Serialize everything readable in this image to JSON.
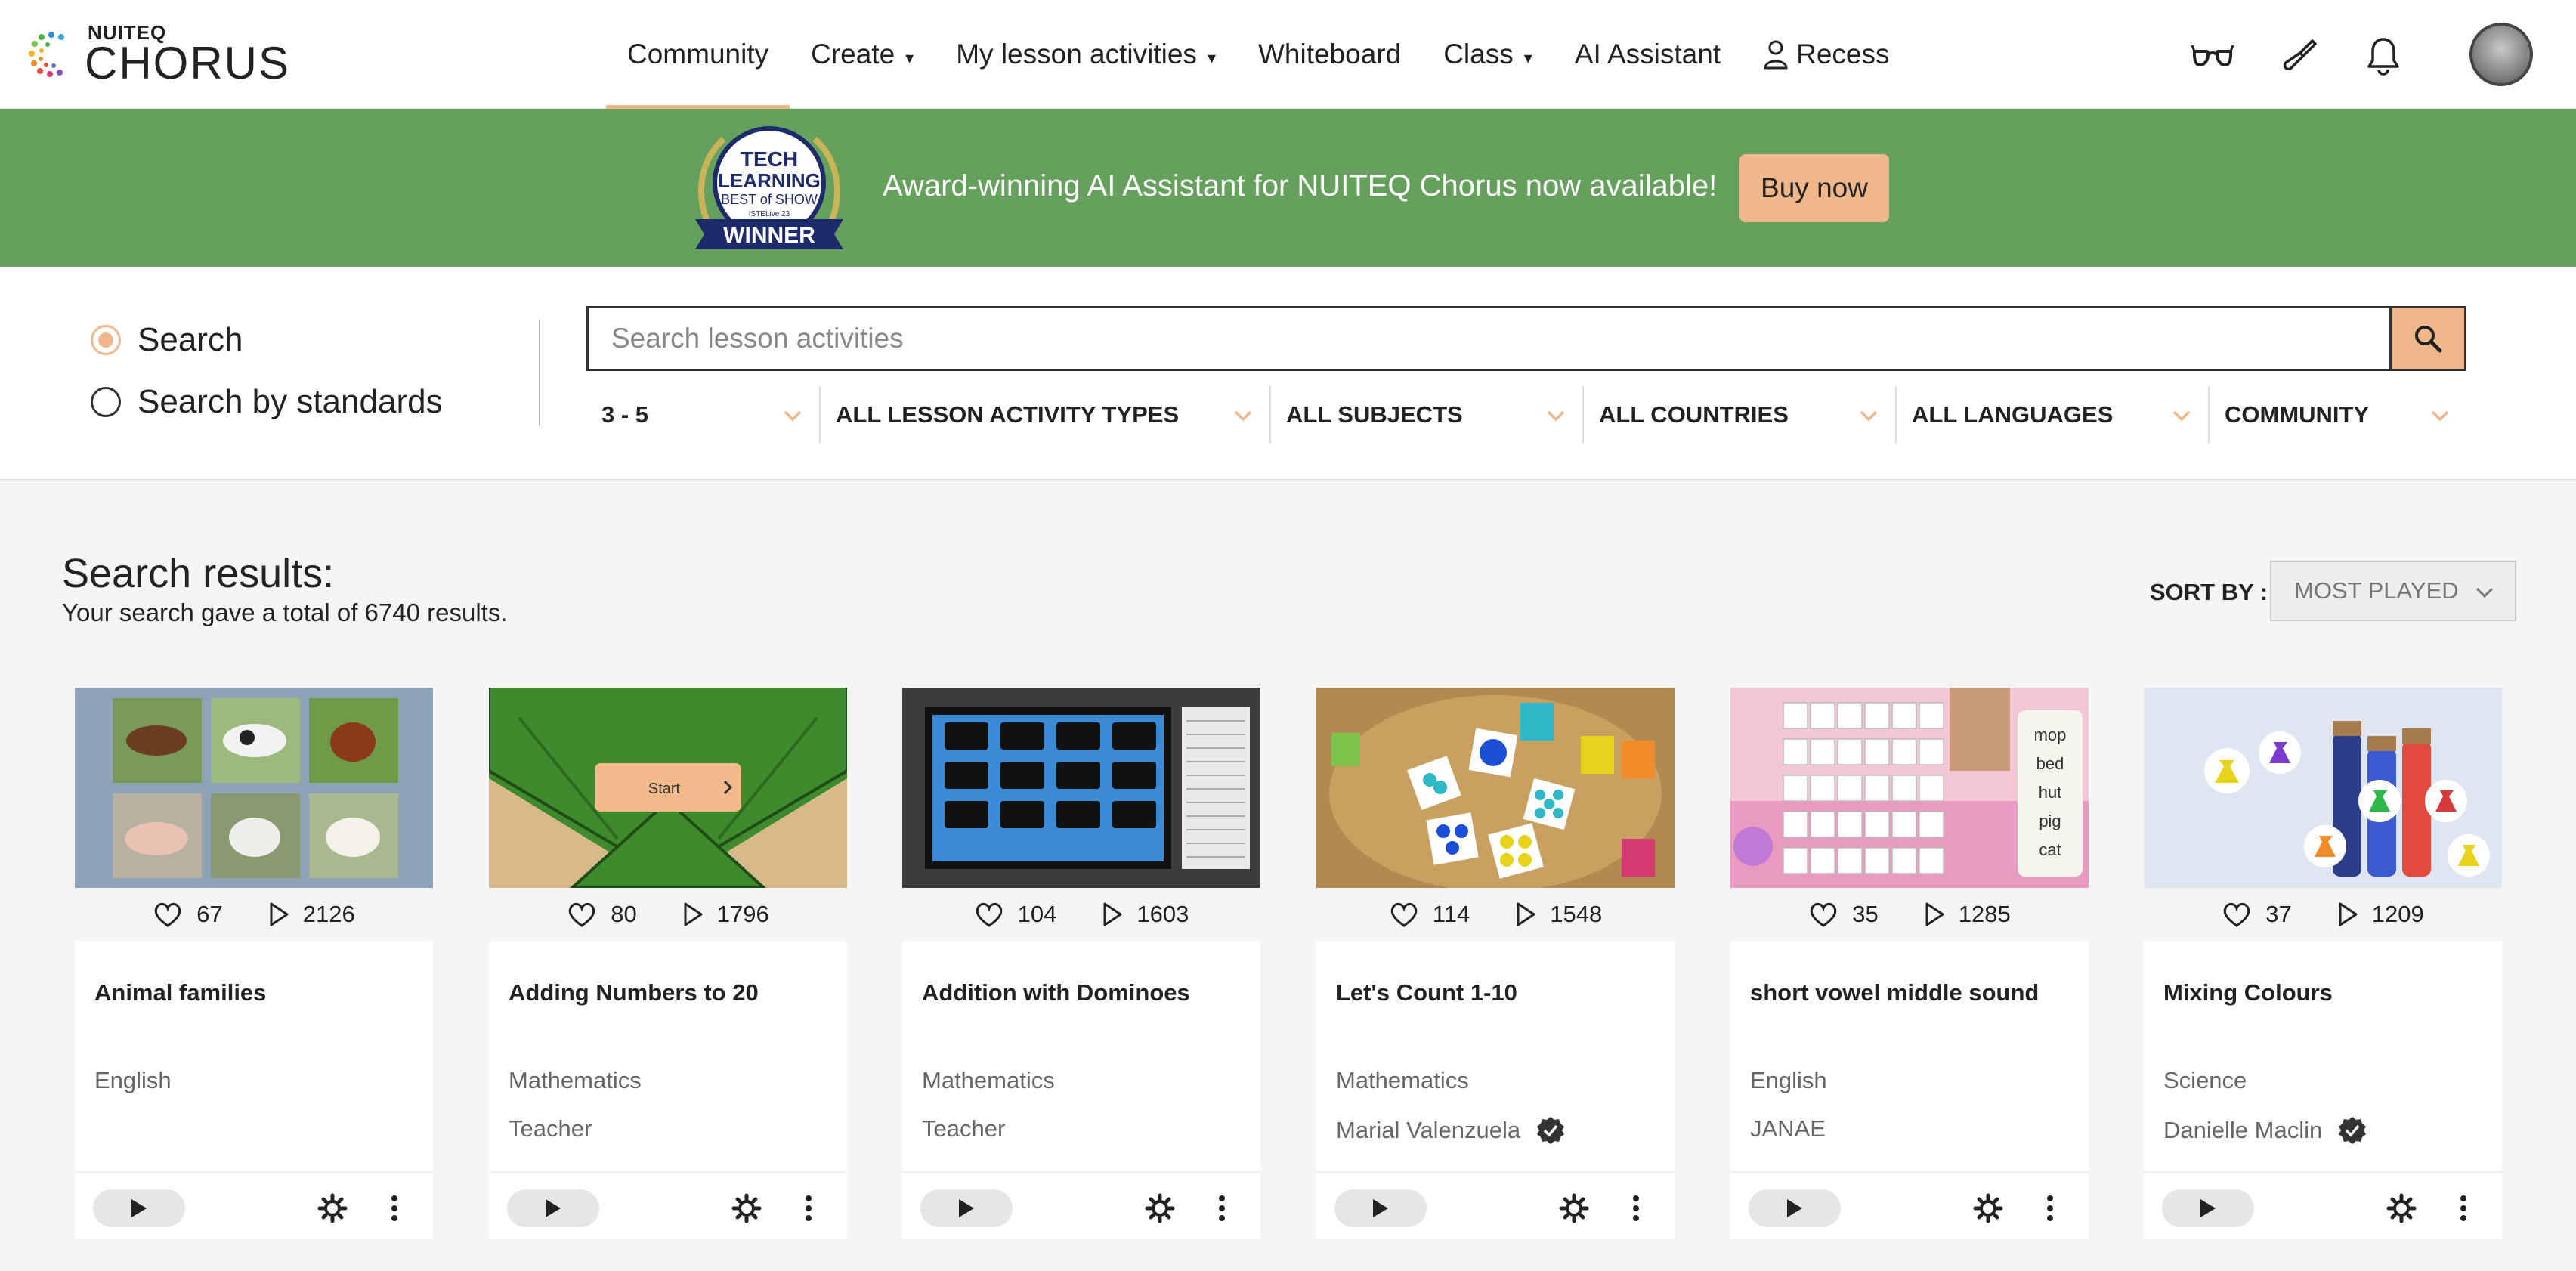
{
  "brand": {
    "small": "NUITEQ",
    "big": "CHORUS"
  },
  "nav": [
    {
      "label": "Community",
      "caret": false
    },
    {
      "label": "Create",
      "caret": true
    },
    {
      "label": "My lesson activities",
      "caret": true
    },
    {
      "label": "Whiteboard",
      "caret": false
    },
    {
      "label": "Class",
      "caret": true
    },
    {
      "label": "AI Assistant",
      "caret": false
    },
    {
      "label": "Recess",
      "caret": false
    }
  ],
  "banner": {
    "badge": {
      "line1": "TECH",
      "line2": "LEARNING",
      "line3": "BEST of SHOW",
      "line4": "ISTELive 23",
      "line5": "WINNER"
    },
    "text": "Award-winning AI Assistant for NUITEQ Chorus now available!",
    "button": "Buy now",
    "color": "#65a05c"
  },
  "search": {
    "mode_options": [
      "Search",
      "Search by standards"
    ],
    "selected_mode": "Search",
    "placeholder": "Search lesson activities",
    "value": ""
  },
  "filters": [
    "3 - 5",
    "ALL LESSON ACTIVITY TYPES",
    "ALL SUBJECTS",
    "ALL COUNTRIES",
    "ALL LANGUAGES",
    "COMMUNITY"
  ],
  "results": {
    "title": "Search results:",
    "summary": "Your search gave a total of 6740 results.",
    "sort_label": "SORT BY :",
    "sort_value": "MOST PLAYED"
  },
  "cards": [
    {
      "title": "Animal families",
      "subject": "English",
      "author": "",
      "verified": false,
      "likes": "67",
      "plays": "2126"
    },
    {
      "title": "Adding Numbers to 20",
      "subject": "Mathematics",
      "author": "Teacher",
      "verified": false,
      "likes": "80",
      "plays": "1796",
      "start_label": "Start"
    },
    {
      "title": "Addition with Dominoes",
      "subject": "Mathematics",
      "author": "Teacher",
      "verified": false,
      "likes": "104",
      "plays": "1603"
    },
    {
      "title": "Let's Count 1-10",
      "subject": "Mathematics",
      "author": "Marial Valenzuela",
      "verified": true,
      "likes": "114",
      "plays": "1548"
    },
    {
      "title": "short vowel middle sound",
      "subject": "English",
      "author": "JANAE",
      "verified": false,
      "likes": "35",
      "plays": "1285",
      "words": [
        "mop",
        "bed",
        "hut",
        "pig",
        "cat"
      ]
    },
    {
      "title": "Mixing Colours",
      "subject": "Science",
      "author": "Danielle Maclin",
      "verified": true,
      "likes": "37",
      "plays": "1209"
    }
  ],
  "colors": {
    "accent": "#f0b88a",
    "banner": "#65a05c",
    "text": "#222222",
    "muted": "#666666"
  }
}
